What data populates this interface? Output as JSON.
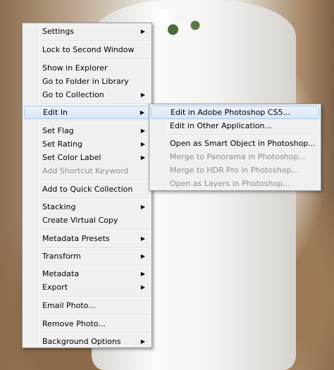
{
  "context_menu": {
    "items": [
      {
        "label": "Settings",
        "submenu": true
      },
      {
        "label": "Lock to Second Window"
      },
      {
        "label": "Show in Explorer"
      },
      {
        "label": "Go to Folder in Library"
      },
      {
        "label": "Go to Collection",
        "submenu": true
      },
      {
        "label": "Edit In",
        "submenu": true,
        "highlighted": true
      },
      {
        "label": "Set Flag",
        "submenu": true
      },
      {
        "label": "Set Rating",
        "submenu": true
      },
      {
        "label": "Set Color Label",
        "submenu": true
      },
      {
        "label": "Add Shortcut Keyword",
        "disabled": true
      },
      {
        "label": "Add to Quick Collection"
      },
      {
        "label": "Stacking",
        "submenu": true
      },
      {
        "label": "Create Virtual Copy"
      },
      {
        "label": "Metadata Presets",
        "submenu": true
      },
      {
        "label": "Transform",
        "submenu": true
      },
      {
        "label": "Metadata",
        "submenu": true
      },
      {
        "label": "Export",
        "submenu": true
      },
      {
        "label": "Email Photo..."
      },
      {
        "label": "Remove Photo..."
      },
      {
        "label": "Background Options",
        "submenu": true
      }
    ],
    "submenu_arrow": "▶"
  },
  "edit_in_submenu": {
    "items": [
      {
        "label": "Edit in Adobe Photoshop CS5...",
        "highlighted": true
      },
      {
        "label": "Edit in Other Application..."
      },
      {
        "label": "Open as Smart Object in Photoshop..."
      },
      {
        "label": "Merge to Panorama in Photoshop...",
        "disabled": true
      },
      {
        "label": "Merge to HDR Pro in Photoshop...",
        "disabled": true
      },
      {
        "label": "Open as Layers in Photoshop...",
        "disabled": true
      }
    ]
  }
}
